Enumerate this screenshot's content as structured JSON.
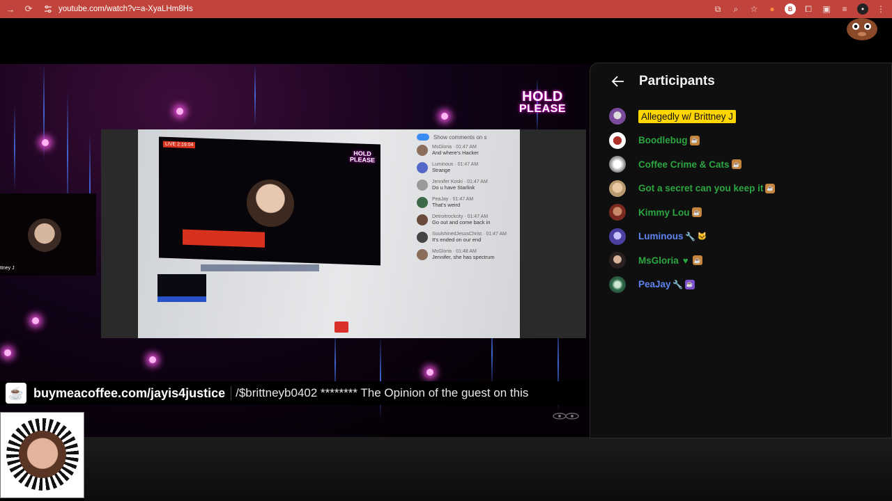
{
  "browser": {
    "url": "youtube.com/watch?v=a-XyaLHm8Hs"
  },
  "stream": {
    "hold_line1": "HOLD",
    "hold_line2": "PLEASE",
    "guest_label": "ttney J",
    "ticker_link": "buymeacoffee.com/jayis4justice",
    "ticker_text": "/$brittneyb0402 ******** The Opinion of the guest on this"
  },
  "embedded_screen": {
    "live_badge": "LIVE 2:19:04",
    "show_comments": "Show comments on s",
    "comments": [
      {
        "name": "MsGloria",
        "time": "01:47 AM",
        "text": "And where's Hacker"
      },
      {
        "name": "Luminous",
        "time": "01:47 AM",
        "text": "Strange"
      },
      {
        "name": "Jennifer Koski",
        "time": "01:47 AM",
        "text": "Do u have Starlink"
      },
      {
        "name": "PeaJay",
        "time": "01:47 AM",
        "text": "That's weird"
      },
      {
        "name": "Detroitrockcity",
        "time": "01:47 AM",
        "text": "Go out and come back in"
      },
      {
        "name": "SoulshinedJesusChrist",
        "time": "01:47 AM",
        "text": "It's ended on our end"
      },
      {
        "name": "MsGloria",
        "time": "01:48 AM",
        "text": "Jennifer, she has spectrum"
      }
    ]
  },
  "panel": {
    "title": "Participants",
    "participants": [
      {
        "name": "Allegedly w/ Brittney J",
        "role": "owner",
        "badges": []
      },
      {
        "name": "Boodlebug",
        "role": "member",
        "badges": [
          "member-badge"
        ]
      },
      {
        "name": "Coffee Crime & Cats",
        "role": "member",
        "badges": [
          "member-badge"
        ]
      },
      {
        "name": "Got a secret can you keep it",
        "role": "member",
        "badges": [
          "member-badge"
        ]
      },
      {
        "name": "Kimmy Lou",
        "role": "member",
        "badges": [
          "member-badge"
        ]
      },
      {
        "name": "Luminous",
        "role": "moderator",
        "badges": [
          "wrench-icon",
          "cat-badge"
        ]
      },
      {
        "name": "MsGloria",
        "role": "member",
        "badges": [
          "heart-icon",
          "member-badge"
        ]
      },
      {
        "name": "PeaJay",
        "role": "moderator",
        "badges": [
          "wrench-icon",
          "member-badge"
        ]
      }
    ]
  },
  "colors": {
    "topbar": "#c0443b",
    "member_name": "#2ba640",
    "moderator_name": "#5e84f1",
    "owner_highlight": "#ffd600"
  }
}
